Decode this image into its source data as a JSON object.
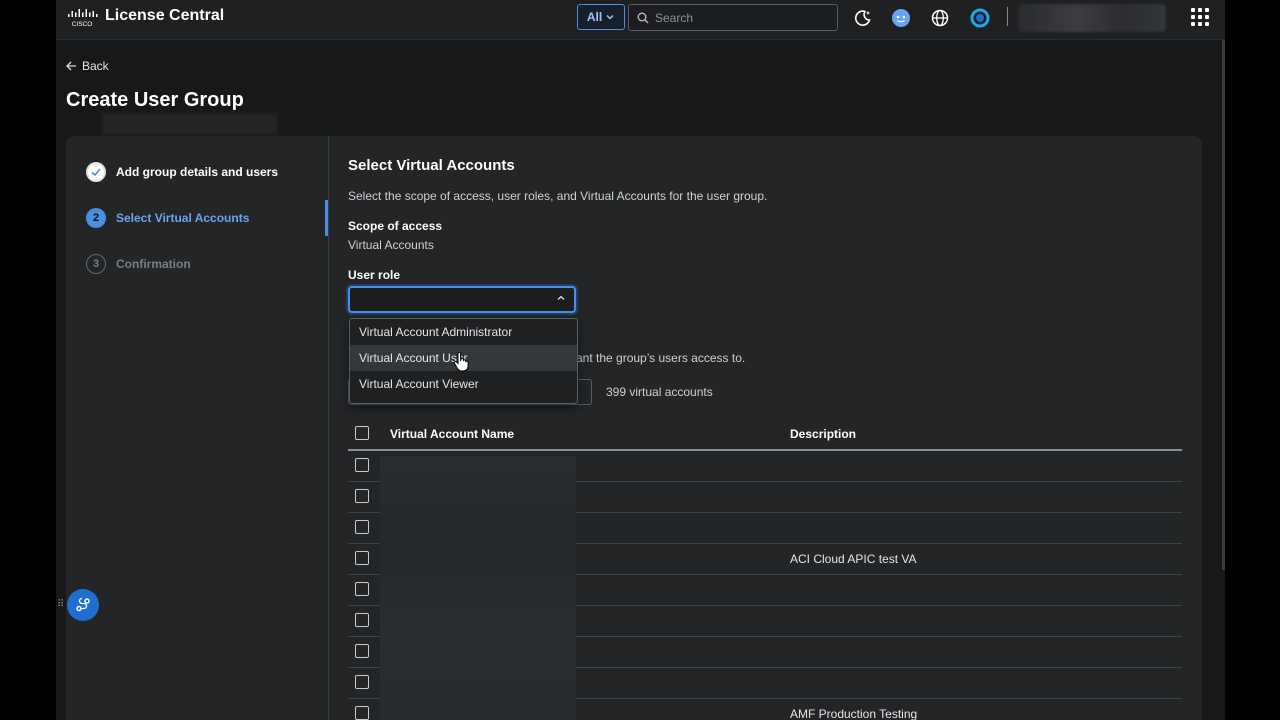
{
  "header": {
    "app_title": "License Central",
    "scope_label": "All",
    "search_placeholder": "Search"
  },
  "nav": {
    "back_label": "Back"
  },
  "page": {
    "title": "Create User Group"
  },
  "steps": [
    {
      "number": "",
      "label": "Add group details and users",
      "state": "done"
    },
    {
      "number": "2",
      "label": "Select Virtual Accounts",
      "state": "active"
    },
    {
      "number": "3",
      "label": "Confirmation",
      "state": "todo"
    }
  ],
  "content": {
    "section_title": "Select Virtual Accounts",
    "section_desc": "Select the scope of access, user roles, and Virtual Accounts for the user group.",
    "scope_label": "Scope of access",
    "scope_value": "Virtual Accounts",
    "role_label": "User role",
    "behind_text": "ant the group’s users access to.",
    "va_count": "399 virtual accounts"
  },
  "role_options": [
    "Virtual Account Administrator",
    "Virtual Account User",
    "Virtual Account Viewer"
  ],
  "table": {
    "col_name": "Virtual Account Name",
    "col_desc": "Description",
    "rows": [
      {
        "desc": ""
      },
      {
        "desc": ""
      },
      {
        "desc": ""
      },
      {
        "desc": "ACI Cloud APIC test VA"
      },
      {
        "desc": ""
      },
      {
        "desc": ""
      },
      {
        "desc": ""
      },
      {
        "desc": ""
      },
      {
        "desc": "AMF Production Testing"
      }
    ]
  },
  "colors": {
    "accent": "#4a8fe0",
    "bg": "#161819",
    "card": "#232527"
  }
}
